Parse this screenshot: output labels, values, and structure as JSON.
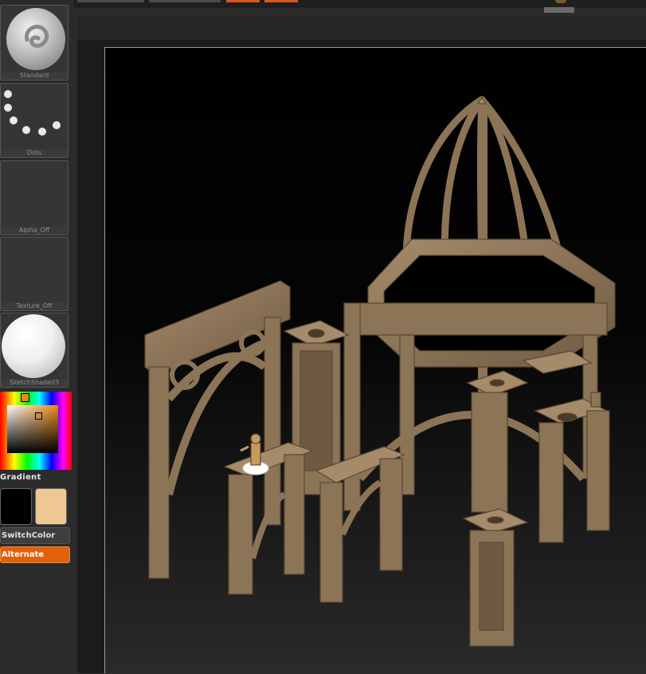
{
  "tray": {
    "slots": [
      {
        "label": "Standard"
      },
      {
        "label": "Dots"
      },
      {
        "label": "Alpha_Off"
      },
      {
        "label": "Texture_Off"
      },
      {
        "label": "SketchShaded3"
      }
    ],
    "gradient_label": "Gradient",
    "switch_color_label": "SwitchColor",
    "alternate_label": "Alternate",
    "main_color": "#000000",
    "secondary_color": "#f0c896"
  },
  "colors": {
    "accent": "#e0600c",
    "model": "#8c7457"
  }
}
